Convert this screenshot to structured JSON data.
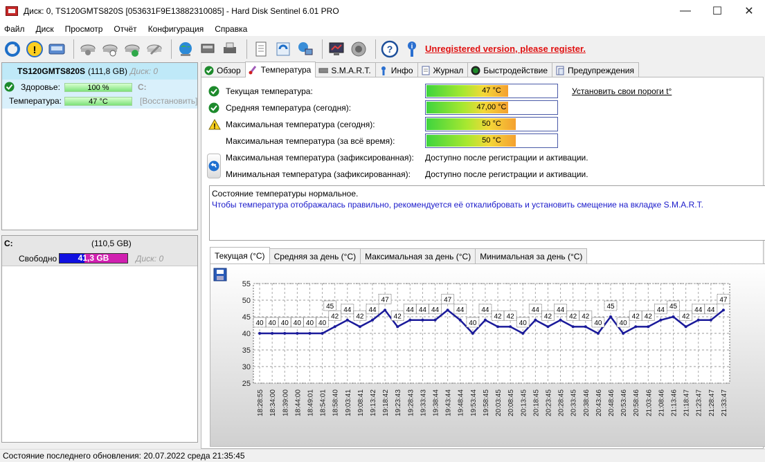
{
  "window": {
    "title": "Диск: 0, TS120GMTS820S [053631F9E13882310085]  -  Hard Disk Sentinel 6.01 PRO",
    "controls": {
      "minimize": "—",
      "maximize": "☐",
      "close": "✕"
    }
  },
  "menu": [
    "Файл",
    "Диск",
    "Просмотр",
    "Отчёт",
    "Конфигурация",
    "Справка"
  ],
  "toolbar": {
    "icons": [
      "refresh-icon",
      "warning-icon",
      "disk-icon",
      "disk-search-icon",
      "disk-info-icon",
      "disk-ok-icon",
      "disk-tool-icon",
      "globe-icon",
      "network-disk-icon",
      "printer-icon",
      "report-icon",
      "update-icon",
      "network-icon",
      "monitor-icon",
      "sound-icon",
      "help-icon",
      "info-icon"
    ],
    "unregistered": "Unregistered version, please register."
  },
  "disk": {
    "name": "TS120GMTS820S",
    "size": "(111,8 GB)",
    "disk_label": "Диск: 0",
    "health_label": "Здоровье:",
    "health_value": "100 %",
    "health_percent": 100,
    "health_drive": "C:",
    "temp_label": "Температура:",
    "temp_value": "47 °C",
    "restore": "[Восстановить]"
  },
  "partition": {
    "letter": "C:",
    "size": "(110,5 GB)",
    "free_label": "Свободно",
    "free_value": "41,3 GB",
    "free_percent": 37,
    "disk_label": "Диск: 0"
  },
  "tabs": [
    {
      "label": "Обзор",
      "icon": "check-icon"
    },
    {
      "label": "Температура",
      "icon": "thermometer-icon"
    },
    {
      "label": "S.M.A.R.T.",
      "icon": "smart-icon"
    },
    {
      "label": "Инфо",
      "icon": "info-icon"
    },
    {
      "label": "Журнал",
      "icon": "journal-icon"
    },
    {
      "label": "Быстродействие",
      "icon": "speed-icon"
    },
    {
      "label": "Предупреждения",
      "icon": "alerts-icon"
    }
  ],
  "temperature": {
    "rows": [
      {
        "label": "Текущая температура:",
        "value": "47 °C",
        "level": 0.62,
        "status": "ok"
      },
      {
        "label": "Средняя температура (сегодня):",
        "value": "47,00 °C",
        "level": 0.62,
        "status": "ok"
      },
      {
        "label": "Максимальная температура (сегодня):",
        "value": "50 °C",
        "level": 0.68,
        "status": "warn"
      },
      {
        "label": "Максимальная температура (за всё время):",
        "value": "50 °C",
        "level": 0.68,
        "status": "none"
      }
    ],
    "set_thresholds": "Установить свои пороги t°",
    "logged_rows": [
      {
        "label": "Максимальная температура (зафиксированная):",
        "value": "Доступно после регистрации и активации."
      },
      {
        "label": "Минимальная температура (зафиксированная):",
        "value": "Доступно после регистрации и активации."
      }
    ],
    "message1": "Состояние температуры нормальное.",
    "message2": "Чтобы температура отображалась правильно, рекомендуется её откалибровать и установить смещение на вкладке S.M.A.R.T."
  },
  "chart_tabs": [
    "Текущая (°C)",
    "Средняя за день (°C)",
    "Максимальная за день (°C)",
    "Минимальная за день (°C)"
  ],
  "chart_data": {
    "type": "line",
    "title": "",
    "xlabel": "",
    "ylabel": "",
    "ylim": [
      25,
      55
    ],
    "yticks": [
      25,
      30,
      35,
      40,
      45,
      50,
      55
    ],
    "grid": true,
    "x_tick_labels": [
      "18:28:55",
      "18:34:00",
      "18:39:00",
      "18:44:00",
      "18:49:01",
      "18:54:01",
      "18:58:40",
      "19:03:41",
      "19:08:41",
      "19:13:42",
      "19:18:42",
      "19:23:43",
      "19:28:43",
      "19:33:43",
      "19:38:44",
      "19:43:44",
      "19:48:44",
      "19:53:44",
      "19:58:45",
      "20:03:45",
      "20:08:45",
      "20:13:45",
      "20:18:45",
      "20:23:45",
      "20:28:45",
      "20:33:45",
      "20:38:46",
      "20:43:46",
      "20:48:46",
      "20:53:46",
      "20:58:46",
      "21:03:46",
      "21:08:46",
      "21:13:46",
      "21:18:47",
      "21:23:47",
      "21:28:47",
      "21:33:47"
    ],
    "values": [
      40,
      40,
      40,
      40,
      40,
      40,
      42,
      44,
      42,
      44,
      47,
      42,
      44,
      44,
      44,
      47,
      44,
      40,
      44,
      42,
      42,
      40,
      44,
      42,
      44,
      42,
      42,
      40,
      45,
      40,
      42,
      42,
      44,
      45,
      42,
      44,
      44,
      47
    ],
    "extra_labels": [
      {
        "after_index": 5,
        "value": 45
      }
    ],
    "series_color": "#1a1a9a"
  },
  "status": "Состояние последнего обновления: 20.07.2022 среда 21:35:45"
}
